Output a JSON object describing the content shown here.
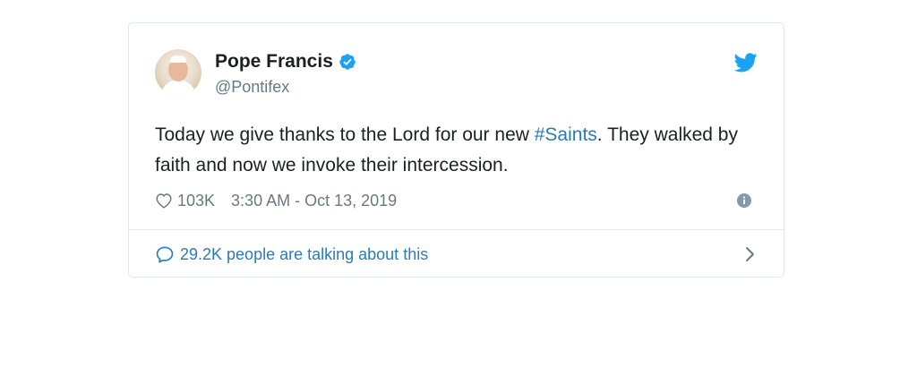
{
  "tweet": {
    "author_name": "Pope Francis",
    "author_handle": "@Pontifex",
    "text_before": "Today we give thanks to the Lord for our new ",
    "hashtag": "#Saints",
    "text_after": ". They walked by faith and now we invoke their intercession.",
    "likes": "103K",
    "timestamp": "3:30 AM - Oct 13, 2019",
    "conversation": "29.2K people are talking about this"
  },
  "icons": {
    "verified": "verified-badge-icon",
    "bird": "twitter-bird-icon",
    "heart": "heart-icon",
    "info": "info-icon",
    "bubble": "comment-bubble-icon",
    "chevron": "chevron-right-icon"
  },
  "colors": {
    "link": "#2b7bb9",
    "brand": "#1da1f2",
    "muted": "#697882",
    "text": "#1c2022",
    "border": "#e1e8ed"
  }
}
